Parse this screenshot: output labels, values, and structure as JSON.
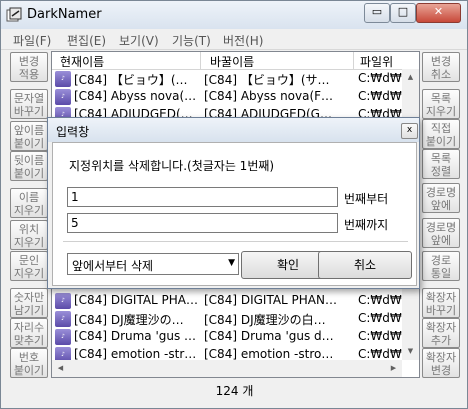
{
  "window": {
    "title": "DarkNamer"
  },
  "titlebar_buttons": {
    "minimize": "▭",
    "maximize": "□",
    "close": "✕"
  },
  "menu": [
    "파일(F)",
    "편집(E)",
    "보기(V)",
    "기능(T)",
    "버전(H)"
  ],
  "left_buttons": [
    [
      "변경",
      "적용"
    ],
    [
      "문자열",
      "바꾸기"
    ],
    [
      "앞이름",
      "붙이기"
    ],
    [
      "뒷이름",
      "붙이기"
    ],
    [
      "이름",
      "지우기"
    ],
    [
      "위치",
      "지우기"
    ],
    [
      "문인",
      "지우기"
    ],
    [
      "숫자만",
      "남기기"
    ],
    [
      "자리수",
      "맞추기"
    ],
    [
      "번호",
      "붙이기"
    ]
  ],
  "right_buttons": [
    [
      "변경",
      "취소"
    ],
    [
      "목록",
      "지우기"
    ],
    [
      "직접",
      "붙이기"
    ],
    [
      "목록",
      "정렬"
    ],
    [
      "경로명",
      "앞에"
    ],
    [
      "경로명",
      "앞에"
    ],
    [
      "경로",
      "통일"
    ],
    [
      "확장자",
      "바꾸기"
    ],
    [
      "확장자",
      "추가"
    ],
    [
      "확장자",
      "변경"
    ]
  ],
  "list": {
    "columns": [
      "현재이름",
      "바꿀이름",
      "파일위"
    ],
    "rows": [
      {
        "current": "[C84] 【ビョウ】(…",
        "new": "[C84] 【ビョウ】(サ…",
        "path": "C:₩d₩"
      },
      {
        "current": "[C84] Abyss nova(…",
        "new": "[C84] Abyss nova(F…",
        "path": "C:₩d₩"
      },
      {
        "current": "[C84] ADJUDGED(…",
        "new": "[C84] ADJUDGED(G…",
        "path": "C:₩d₩"
      },
      {
        "current": "[C84] DIGITAL PHA…",
        "new": "[C84] DIGITAL PHAN…",
        "path": "C:₩d₩"
      },
      {
        "current": "[C84] DJ魔理沙の…",
        "new": "[C84] DJ魔理沙の白…",
        "path": "C:₩d₩"
      },
      {
        "current": "[C84] Druma 'gus …",
        "new": "[C84] Druma 'gus d…",
        "path": "C:₩d₩"
      },
      {
        "current": "[C84] emotion -str…",
        "new": "[C84] emotion -stro…",
        "path": "C:₩d₩"
      }
    ]
  },
  "status": {
    "count": "124 개"
  },
  "dialog": {
    "title": "입력창",
    "close": "x",
    "prompt": "지정위치를 삭제합니다.(첫글자는 1번째)",
    "from_value": "1",
    "from_label": "번째부터",
    "to_value": "5",
    "to_label": "번째까지",
    "mode_selected": "앞에서부터 삭제",
    "ok": "확인",
    "cancel": "취소"
  },
  "colors": {
    "accent": "#5b4ba8",
    "close_button": "#c7493a"
  }
}
